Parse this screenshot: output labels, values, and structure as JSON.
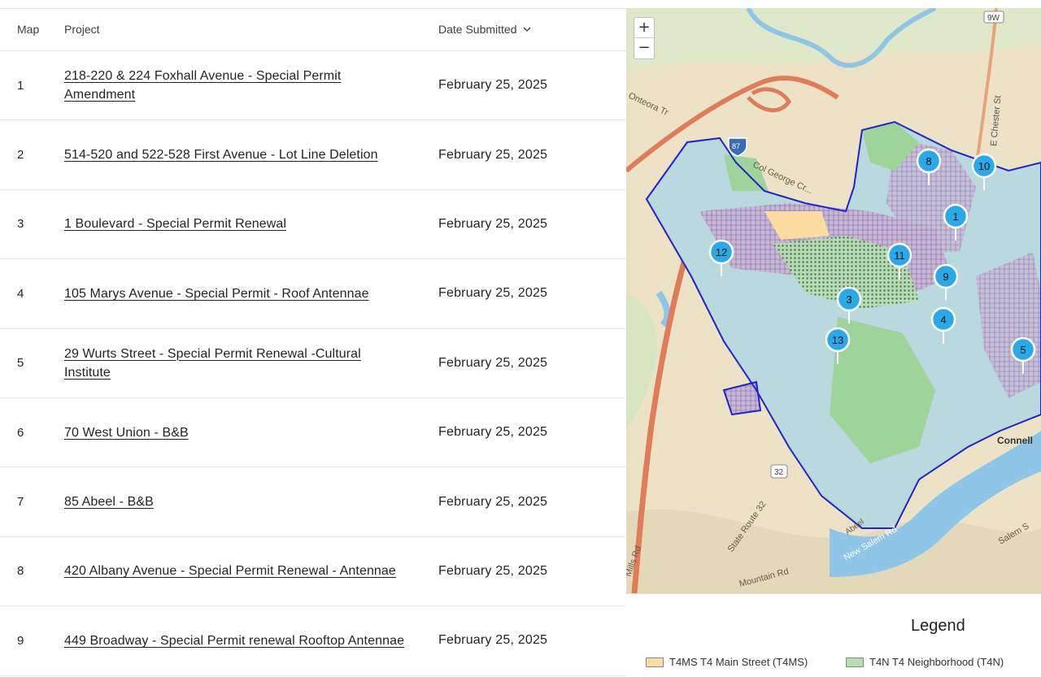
{
  "table": {
    "headers": {
      "map": "Map",
      "project": "Project",
      "date": "Date Submitted"
    },
    "rows": [
      {
        "map": "1",
        "project": "218-220 & 224 Foxhall Avenue - Special Permit Amendment",
        "date": "February 25, 2025"
      },
      {
        "map": "2",
        "project": "514-520 and 522-528 First Avenue - Lot Line Deletion",
        "date": "February 25, 2025"
      },
      {
        "map": "3",
        "project": "1 Boulevard - Special Permit Renewal",
        "date": "February 25, 2025"
      },
      {
        "map": "4",
        "project": "105 Marys Avenue - Special Permit - Roof Antennae",
        "date": "February 25, 2025"
      },
      {
        "map": "5",
        "project": "29 Wurts Street - Special Permit Renewal -Cultural Institute",
        "date": "February 25, 2025"
      },
      {
        "map": "6",
        "project": "70 West Union - B&B",
        "date": "February 25, 2025"
      },
      {
        "map": "7",
        "project": "85 Abeel - B&B",
        "date": "February 25, 2025"
      },
      {
        "map": "8",
        "project": "420 Albany Avenue - Special Permit Renewal - Antennae",
        "date": "February 25, 2025"
      },
      {
        "map": "9",
        "project": "449 Broadway - Special Permit renewal Rooftop Antennae",
        "date": "February 25, 2025"
      }
    ]
  },
  "map": {
    "zoom_in": "+",
    "zoom_out": "−",
    "labels": {
      "route_9w": "9W",
      "e_chester": "E Chester St",
      "route_87": "87",
      "col_george": "Col George Cr...",
      "onteora": "Onteora Tr",
      "route_32_shield": "32",
      "state_route_32": "State Route 32",
      "mills_rd": "Mills Rd",
      "mountain_rd": "Mountain Rd",
      "new_salem": "New Salem Rd",
      "salem": "Salem S",
      "abeel": "Abeel",
      "connell": "Connell"
    },
    "markers": [
      "1",
      "3",
      "4",
      "5",
      "8",
      "9",
      "10",
      "11",
      "12",
      "13"
    ],
    "colors": {
      "boundary": "#2222cc",
      "marker": "#29a9e8",
      "water": "#8fc6e8",
      "highway": "#e07c5a"
    }
  },
  "legend": {
    "title": "Legend",
    "items": [
      {
        "label": "T4MS T4 Main Street (T4MS)",
        "color": "#fcdca3"
      },
      {
        "label": "T4N T4 Neighborhood (T4N)",
        "color": "#b6dfb2"
      }
    ]
  }
}
